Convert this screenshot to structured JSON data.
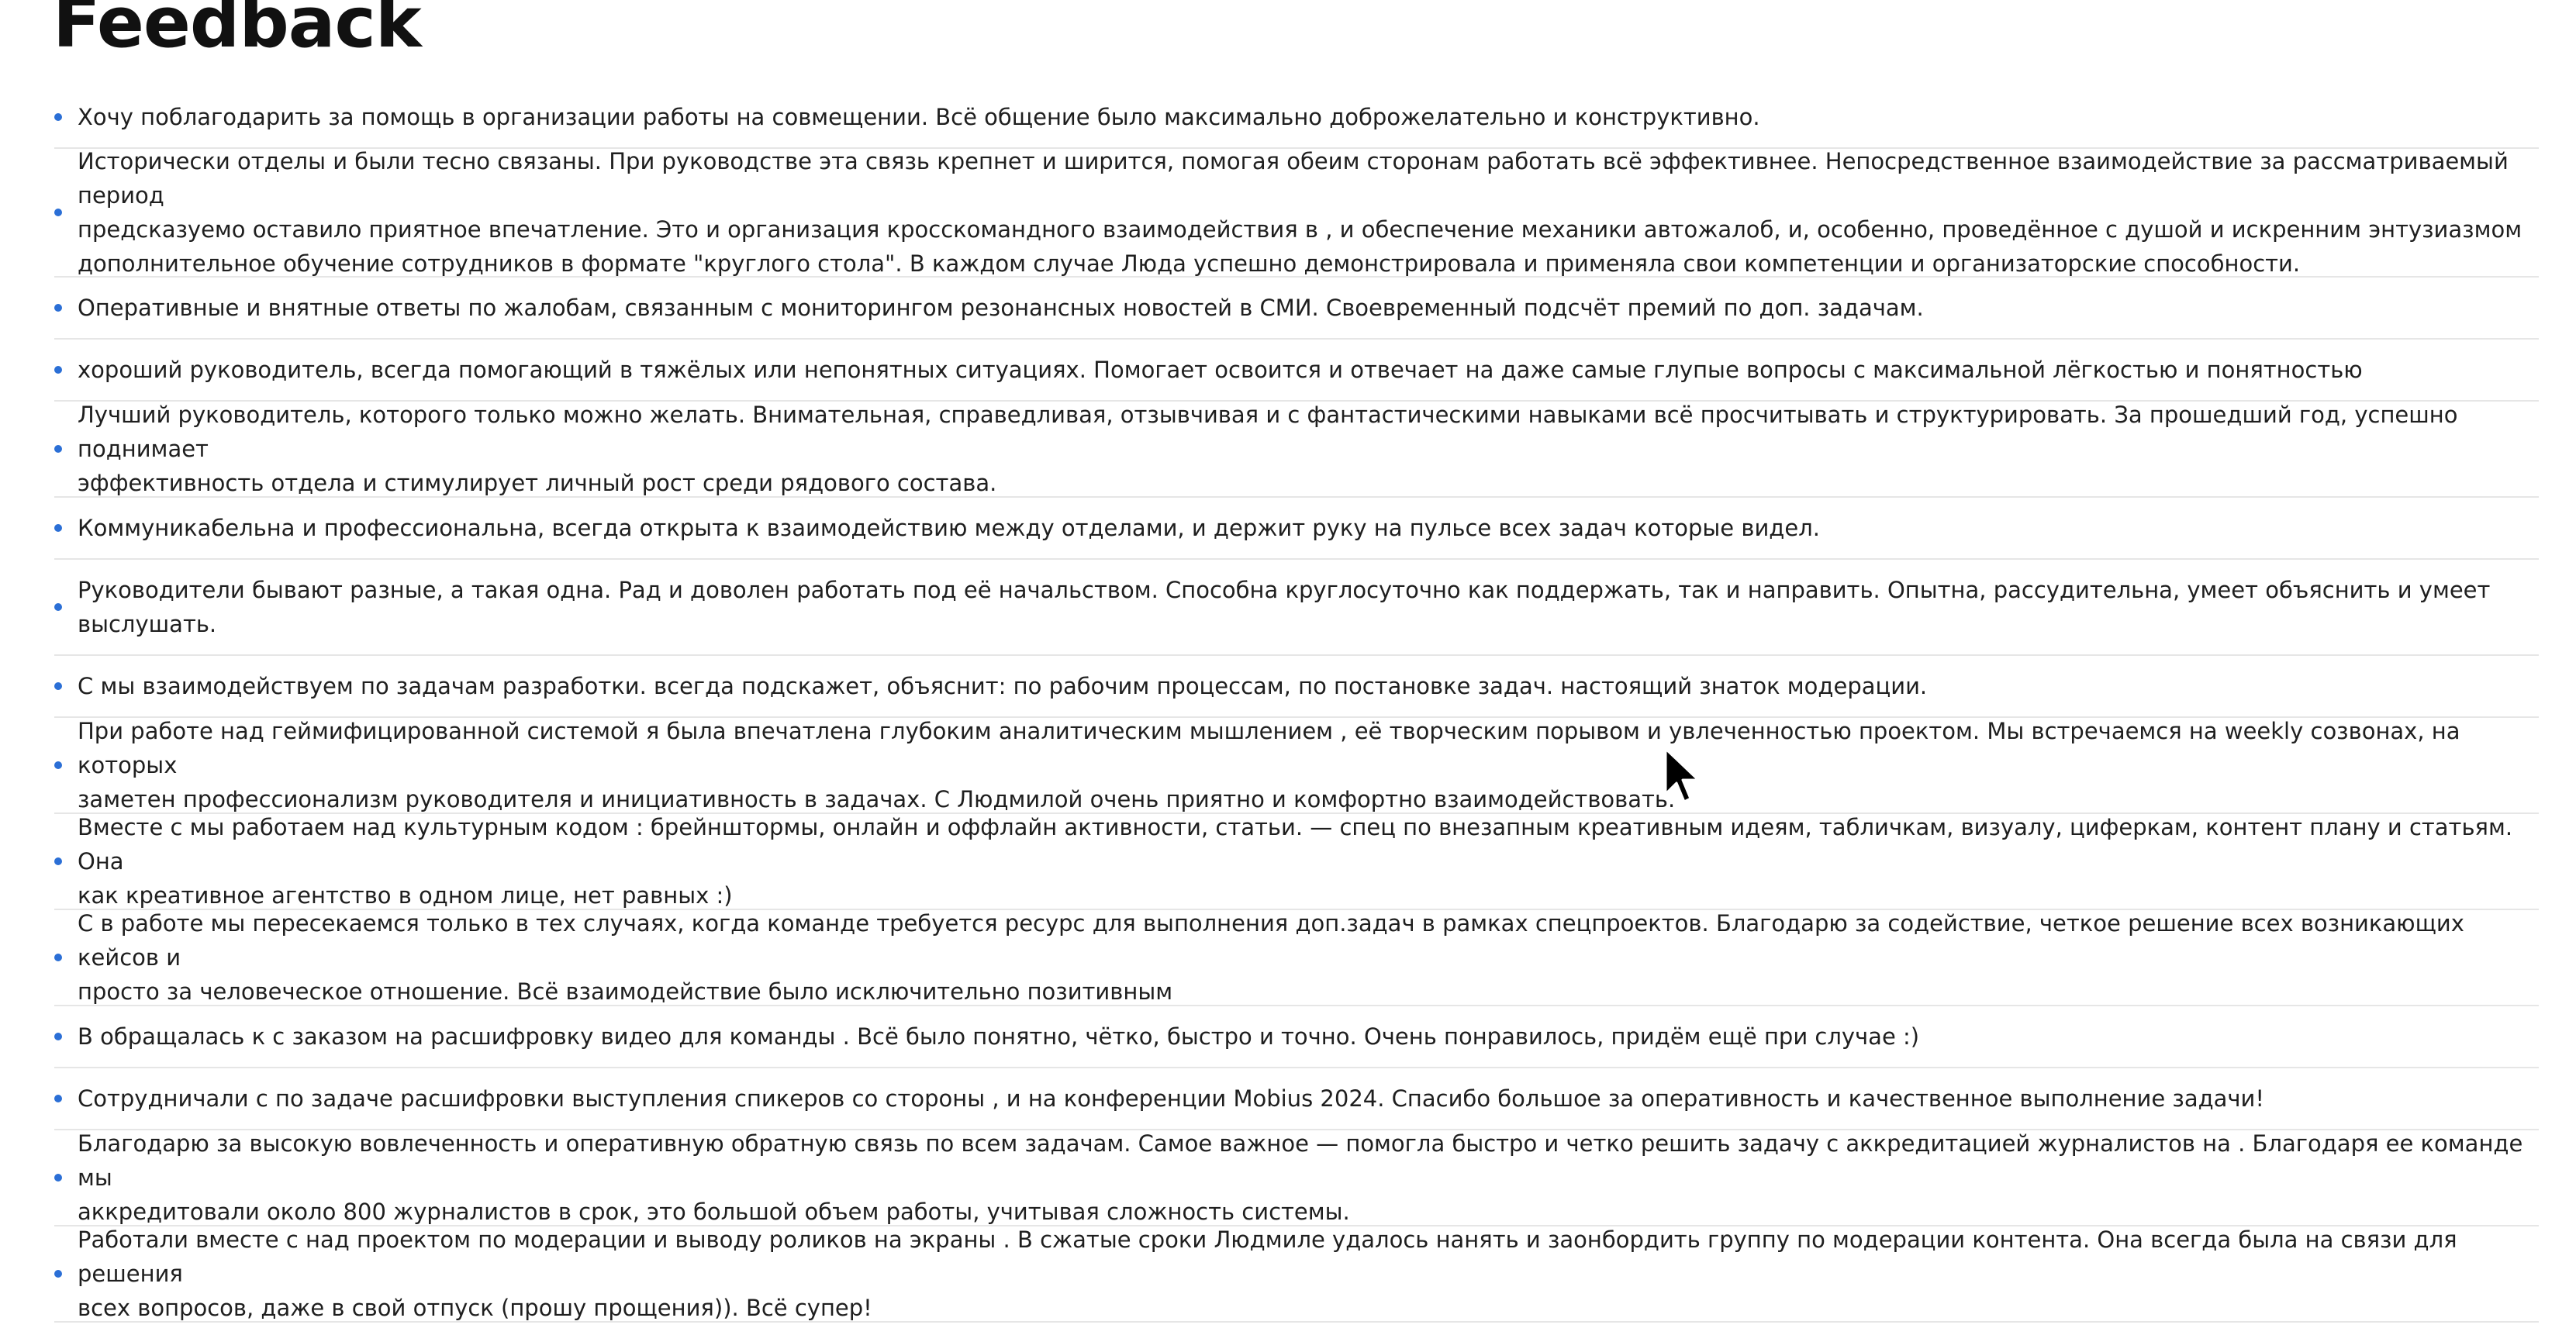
{
  "page": {
    "title": "Feedback"
  },
  "feedback": {
    "items": [
      "Хочу поблагодарить за помощь в организации работы на совмещении. Всё общение было максимально доброжелательно и конструктивно.",
      "Исторически отделы и были тесно связаны. При руководстве эта связь крепнет и ширится, помогая обеим сторонам работать всё эффективнее. Непосредственное взаимодействие за рассматриваемый период\nпредсказуемо оставило приятное впечатление. Это и организация кросскомандного взаимодействия в , и обеспечение механики автожалоб, и, особенно, проведённое с душой и искренним энтузиазмом\nдополнительное обучение сотрудников в формате \"круглого стола\". В каждом случае Люда успешно демонстрировала и применяла свои компетенции и организаторские способности.",
      "Оперативные и внятные ответы по жалобам, связанным с мониторингом резонансных новостей в СМИ. Своевременный подсчёт премий по доп. задачам.",
      "хороший руководитель, всегда помогающий в тяжёлых или непонятных ситуациях. Помогает освоится и отвечает на даже самые глупые вопросы с максимальной лёгкостью и понятностью",
      "Лучший руководитель, которого только можно желать. Внимательная, справедливая, отзывчивая и с фантастическими навыками всё просчитывать и структурировать. За прошедший год, успешно поднимает\nэффективность отдела и стимулирует личный рост среди рядового состава.",
      "Коммуникабельна и профессиональна, всегда открыта к взаимодействию между отделами, и держит руку на пульсе всех задач которые видел.",
      "Руководители бывают разные, а такая одна. Рад и доволен работать под её начальством. Способна круглосуточно как поддержать, так и направить. Опытна, рассудительна, умеет объяснить и умеет\nвыслушать.",
      "С мы взаимодействуем по задачам разработки. всегда подскажет, объяснит: по рабочим процессам, по постановке задач. настоящий знаток модерации.",
      "При работе над геймифицированной системой я была впечатлена глубоким аналитическим мышлением , её творческим порывом и увлеченностью проектом. Мы встречаемся на weekly созвонах, на которых\nзаметен профессионализм руководителя и инициативность в задачах. С Людмилой очень приятно и комфортно взаимодействовать.",
      "Вместе с мы работаем над культурным кодом : брейнштормы, онлайн и оффлайн активности, статьи. — спец по внезапным креативным идеям, табличкам, визуалу, циферкам, контент плану и статьям. Она\nкак креативное агентство в одном лице, нет равных :)",
      "С в работе мы пересекаемся только в тех случаях, когда команде требуется ресурс для выполнения доп.задач в рамках спецпроектов. Благодарю за содействие, четкое решение всех возникающих кейсов и\nпросто за человеческое отношение. Всё взаимодействие было исключительно позитивным",
      "В обращалась к с заказом на расшифровку видео для команды . Всё было понятно, чётко, быстро и точно. Очень понравилось, придём ещё при случае :)",
      "Сотрудничали с по задаче расшифровки выступления спикеров со стороны , и на конференции Mobius 2024. Спасибо большое за оперативность и качественное выполнение задачи!",
      "Благодарю за высокую вовлеченность и оперативную обратную связь по всем задачам. Самое важное — помогла быстро и четко решить задачу с аккредитацией журналистов на . Благодаря ее команде мы\nаккредитовали около 800 журналистов в срок, это большой объем работы, учитывая сложность системы.",
      "Работали вместе с над проектом по модерации и выводу роликов на экраны . В сжатые сроки Людмиле удалось нанять и заонбордить группу по модерации контента. Она всегда была на связи для решения\nвсех вопросов, даже в свой отпуск (прошу прощения)). Всё супер!",
      "Хочу поблагодарить за помощь в организации работы на совмещении. Всё общение было максимально доброжелательно и конструктивно."
    ]
  },
  "colors": {
    "bullet": "#2b6fd6",
    "divider": "#e6e6e6",
    "text": "#1f1f1f"
  },
  "icons": {
    "cursor": "mouse-pointer-icon"
  }
}
